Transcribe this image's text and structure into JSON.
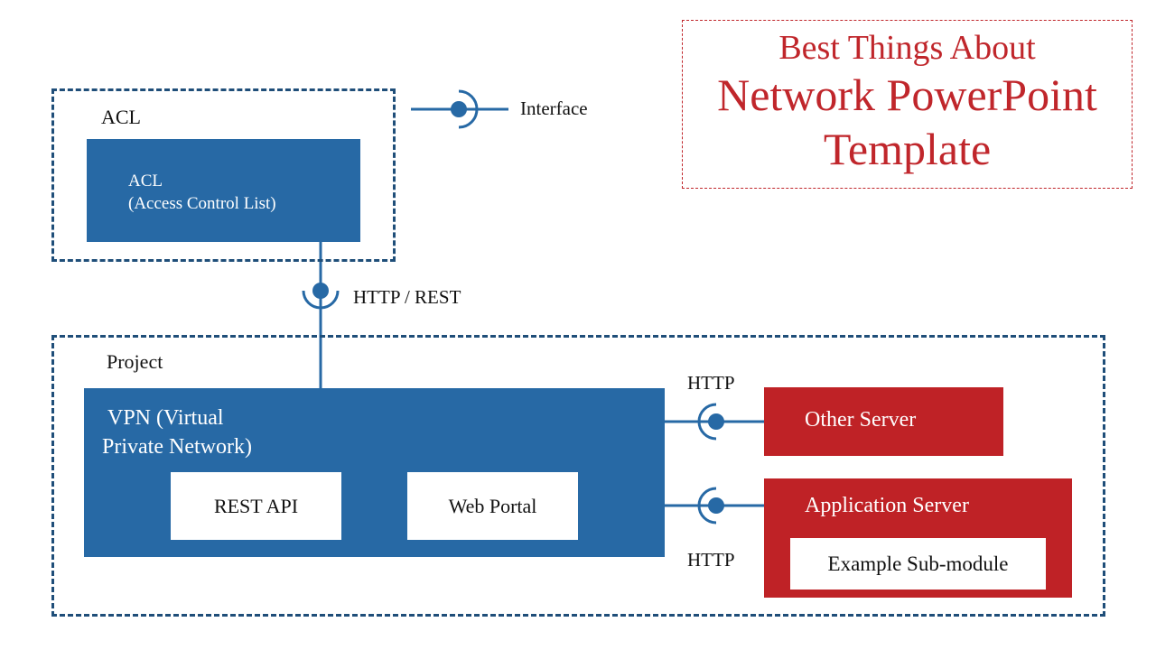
{
  "title": {
    "line1": "Best Things About",
    "line2": "Network PowerPoint",
    "line3": "Template"
  },
  "legend": {
    "interface_label": "Interface"
  },
  "acl_group": {
    "label": "ACL",
    "box_line1": "ACL",
    "box_line2": "(Access Control List)"
  },
  "acl_connection": {
    "label": "HTTP / REST"
  },
  "project_group": {
    "label": "Project",
    "vpn": {
      "line1": "VPN (Virtual",
      "line2": "Private Network)"
    },
    "modules": [
      "REST API",
      "Web Portal"
    ]
  },
  "servers": {
    "other": {
      "label": "Other Server",
      "protocol": "HTTP"
    },
    "application": {
      "label": "Application Server",
      "submodule": "Example Sub-module",
      "protocol": "HTTP"
    }
  },
  "colors": {
    "blue": "#2769a5",
    "dark_blue": "#1f4e79",
    "red": "#bf2226"
  }
}
